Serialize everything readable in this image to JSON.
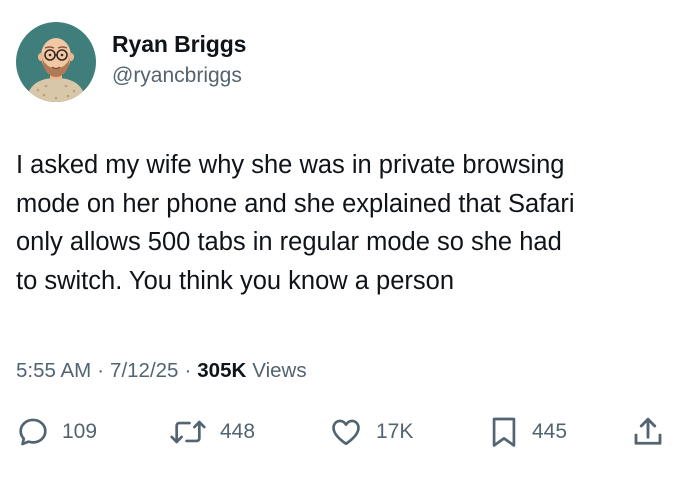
{
  "author": {
    "display_name": "Ryan Briggs",
    "handle": "@ryancbriggs"
  },
  "tweet": {
    "text": "I asked my wife why she was in private browsing\nmode on her phone and she explained that Safari\nonly allows 500 tabs in regular mode so she had\nto switch. You think you know a person"
  },
  "meta": {
    "time": "5:55 AM",
    "separator": "·",
    "date": "7/12/25",
    "views_count": "305K",
    "views_label": "Views"
  },
  "actions": {
    "replies": "109",
    "reposts": "448",
    "likes": "17K",
    "bookmarks": "445"
  },
  "icons": {
    "reply": "speech-bubble-icon",
    "repost": "repost-arrows-icon",
    "like": "heart-icon",
    "bookmark": "bookmark-icon",
    "share": "share-upload-icon"
  },
  "colors": {
    "text_primary": "#0f1419",
    "text_secondary": "#536471",
    "avatar_background": "#3f7e7b"
  }
}
